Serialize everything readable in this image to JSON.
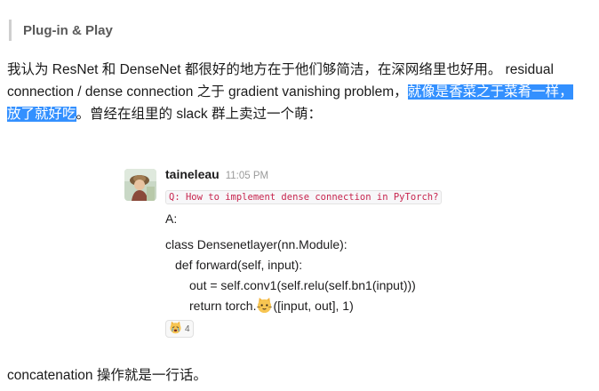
{
  "section": {
    "title": "Plug-in & Play"
  },
  "intro": {
    "part1": "我认为 ResNet 和 DenseNet 都很好的地方在于他们够简洁，在深网络里也好用。 residual connection / dense connection 之于 gradient vanishing problem，",
    "highlighted": "就像是香菜之于菜肴一样，放了就好吃",
    "part2": "。曾经在组里的 slack 群上卖过一个萌："
  },
  "slack_message": {
    "avatar_icon": "user-avatar-photo",
    "username": "taineleau",
    "time": "11:05 PM",
    "question_code": "Q: How to implement dense connection in PyTorch?",
    "answer_label": "A:",
    "code_lines": {
      "line1": "class Densenetlayer(nn.Module):",
      "line2": "def forward(self, input):",
      "line3": "out = self.conv1(self.relu(self.bn1(input)))",
      "line4_before": "return torch.",
      "line4_emoji": "cat-face-emoji",
      "line4_after": "([input, out], 1)"
    },
    "reaction": {
      "emoji": "crying-cat-face-emoji",
      "count": "4"
    }
  },
  "outro": {
    "text": "concatenation 操作就是一行话。"
  },
  "colors": {
    "highlight": "#3390ff",
    "inline_code": "#c7254e"
  }
}
